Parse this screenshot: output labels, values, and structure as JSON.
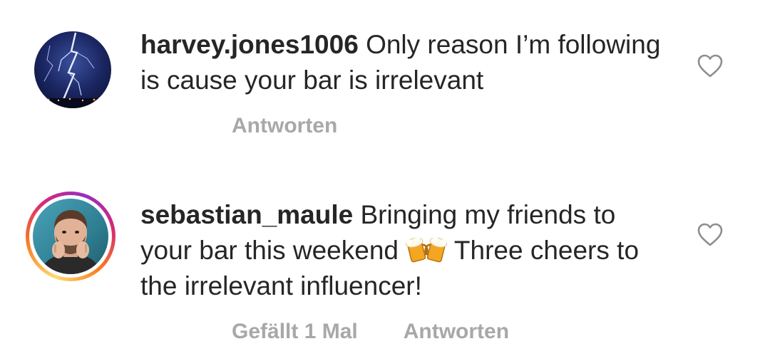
{
  "comments": [
    {
      "username": "harvey.jones1006",
      "text": "Only reason I’m following is cause your bar is irrelevant",
      "avatar_icon": "lightning-storm-avatar",
      "has_story_ring": false,
      "actions": {
        "reply_label": "Antworten"
      }
    },
    {
      "username": "sebastian_maule",
      "text_before_emoji": "Bringing my friends to your bar this weekend",
      "emoji_icon": "beer-mugs-emoji",
      "text_after_emoji": "Three cheers to the irrelevant influencer!",
      "avatar_icon": "profile-photo-avatar",
      "has_story_ring": true,
      "actions": {
        "likes_label": "Gefällt 1 Mal",
        "reply_label": "Antworten"
      }
    }
  ],
  "colors": {
    "text": "#262626",
    "secondary": "#a8a8a8",
    "heart_outline": "#8e8e8e",
    "ring_start": "#feda75",
    "ring_end": "#962fbf"
  },
  "icons": {
    "like": "heart-outline-icon"
  }
}
